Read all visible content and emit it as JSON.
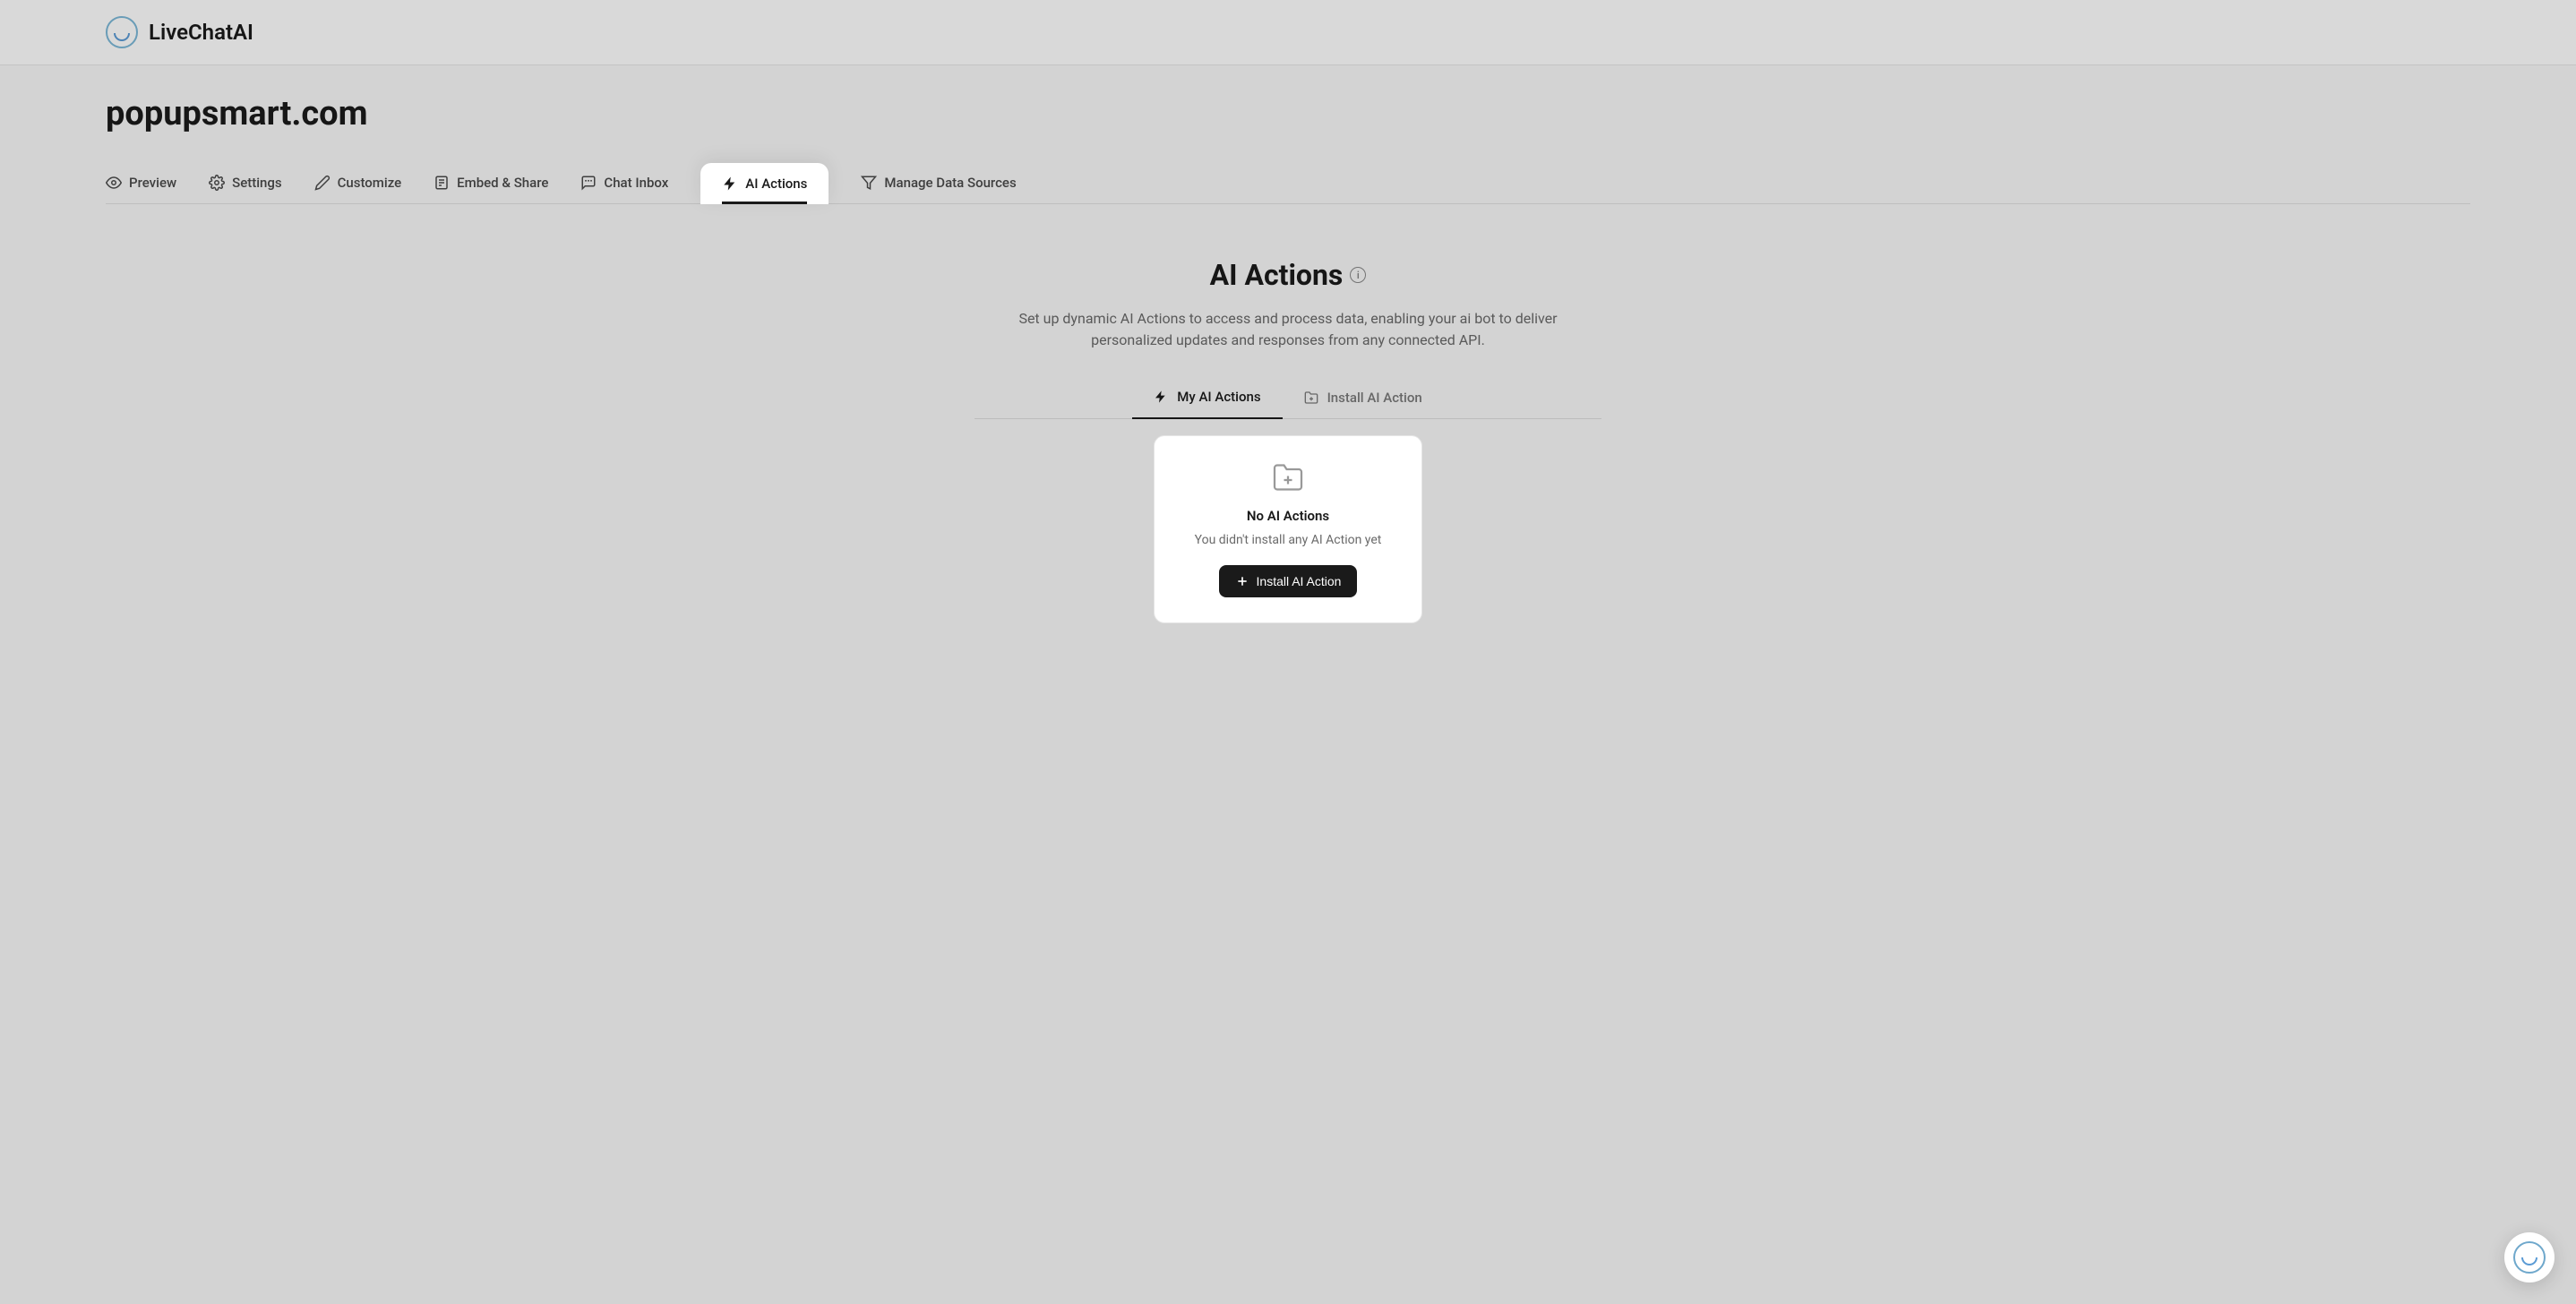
{
  "header": {
    "brand": "LiveChatAI"
  },
  "page": {
    "title": "popupsmart.com"
  },
  "nav": {
    "preview": "Preview",
    "settings": "Settings",
    "customize": "Customize",
    "embed": "Embed & Share",
    "chat_inbox": "Chat Inbox",
    "ai_actions": "AI Actions",
    "manage_data": "Manage Data Sources"
  },
  "main": {
    "title": "AI Actions",
    "description": "Set up dynamic AI Actions to access and process data, enabling your ai bot to deliver personalized updates and responses from any connected API."
  },
  "subtabs": {
    "my_actions": "My AI Actions",
    "install_action": "Install AI Action"
  },
  "empty": {
    "title": "No AI Actions",
    "description": "You didn't install any AI Action yet",
    "button": "Install AI Action"
  }
}
